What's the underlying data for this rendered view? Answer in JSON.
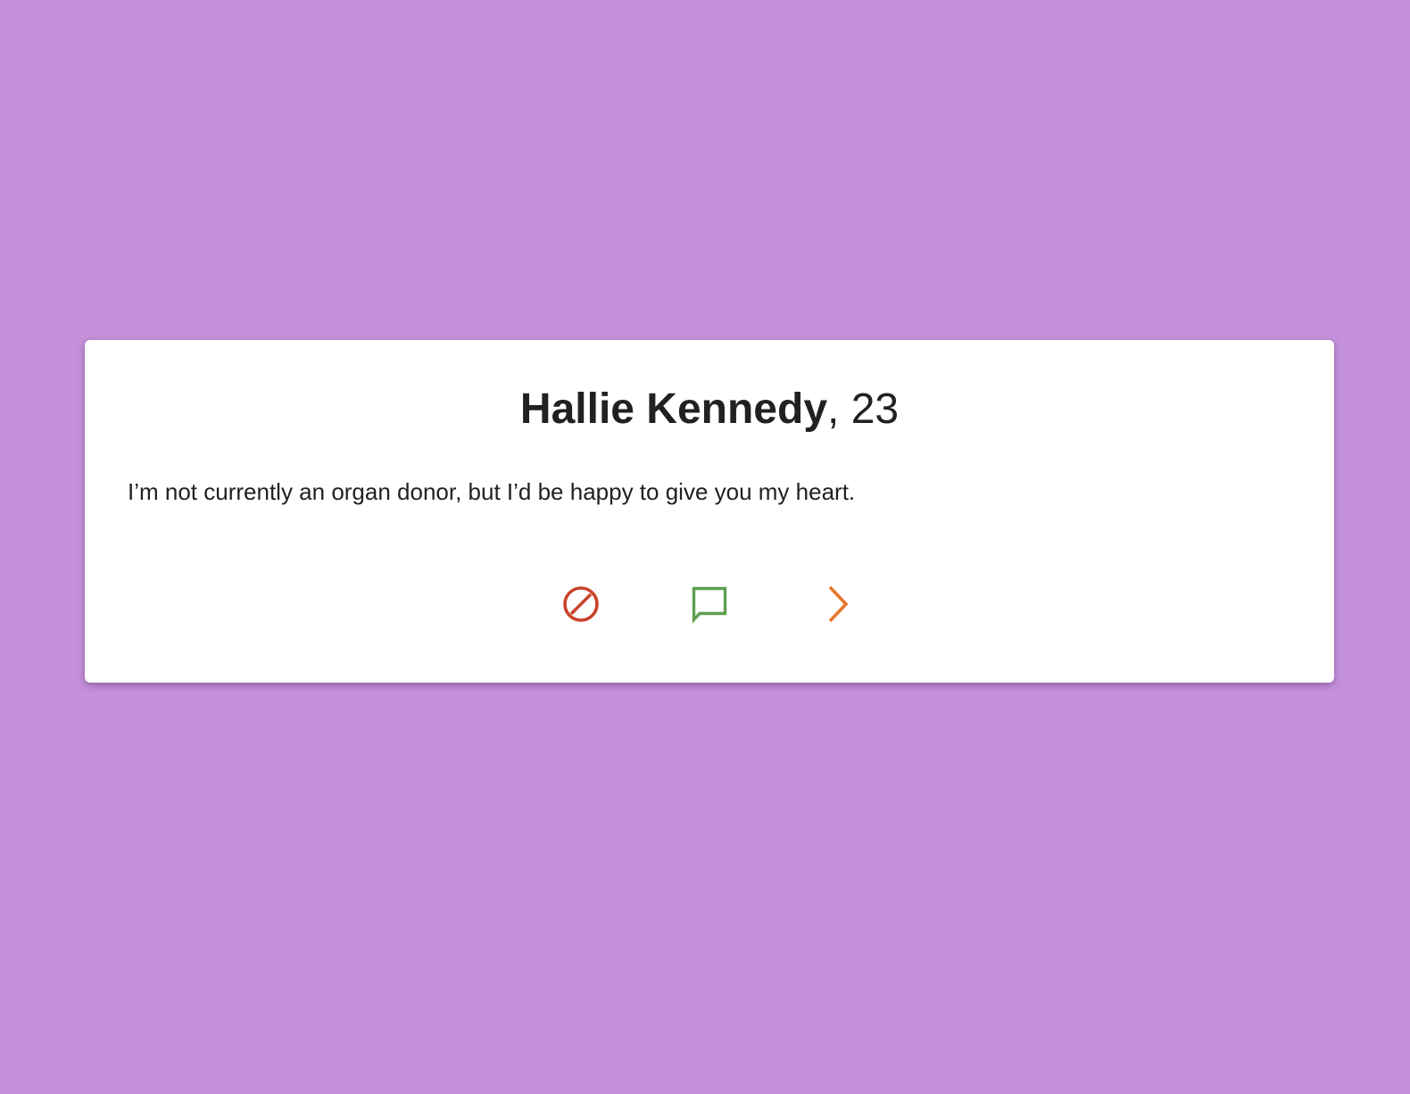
{
  "profile": {
    "name": "Hallie Kennedy",
    "age_suffix": ", 23",
    "bio": "I’m not currently an organ donor, but I’d be happy to give you my heart."
  },
  "actions": {
    "block": {
      "icon": "block-icon",
      "color": "#c9432a"
    },
    "message": {
      "icon": "message-icon",
      "color": "#5f9e50"
    },
    "next": {
      "icon": "chevron-right-icon",
      "color": "#e8762e"
    }
  },
  "colors": {
    "background": "#c491da",
    "card": "#ffffff",
    "text": "#212121"
  }
}
